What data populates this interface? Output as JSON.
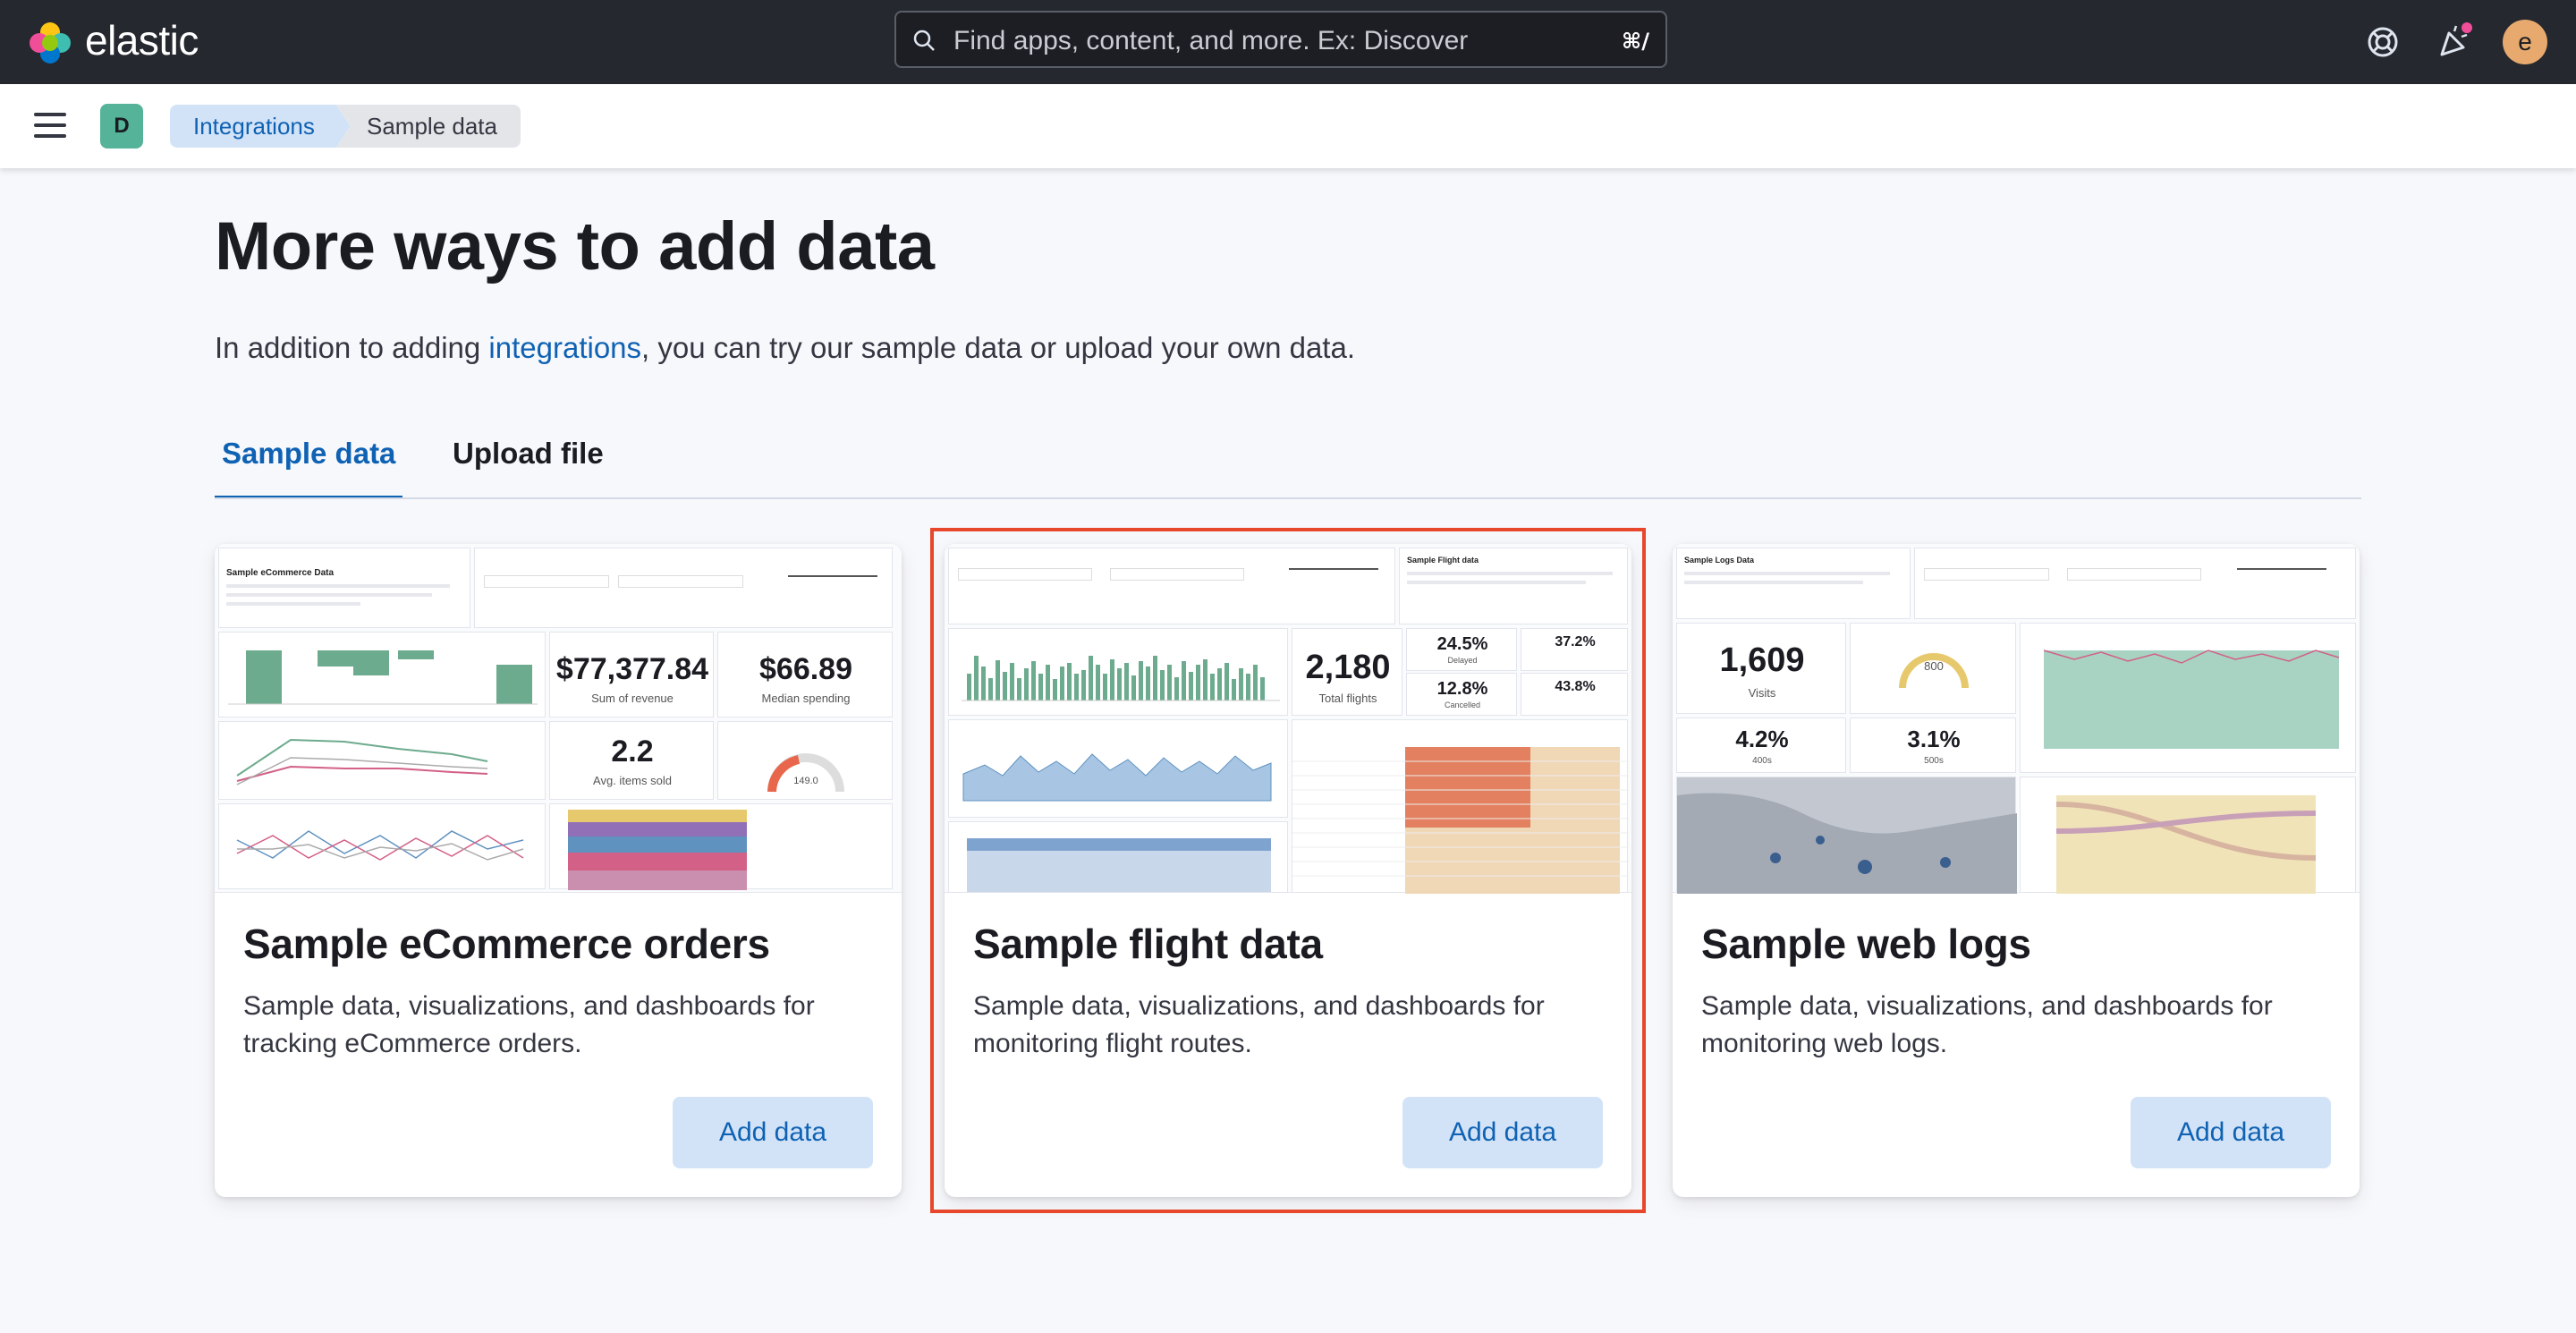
{
  "header": {
    "logo_text": "elastic",
    "search_placeholder": "Find apps, content, and more. Ex: Discover",
    "search_shortcut": "⌘/",
    "avatar_initial": "e",
    "icons": [
      "help-icon",
      "newsfeed-icon",
      "avatar"
    ]
  },
  "nav": {
    "space_initial": "D",
    "breadcrumbs": [
      "Integrations",
      "Sample data"
    ]
  },
  "page": {
    "title": "More ways to add data",
    "intro_before": "In addition to adding ",
    "intro_link": "integrations",
    "intro_after": ", you can try our sample data or upload your own data.",
    "tabs": [
      "Sample data",
      "Upload file"
    ],
    "selected_tab": "Sample data"
  },
  "cards": [
    {
      "title": "Sample eCommerce orders",
      "description": "Sample data, visualizations, and dashboards for tracking eCommerce orders.",
      "button": "Add data",
      "preview": {
        "heading": "Sample eCommerce Data",
        "stat1": "$77,377.84",
        "stat1_label": "Sum of revenue",
        "stat2": "$66.89",
        "stat2_label": "Median spending",
        "stat3": "2.2",
        "stat3_label": "Avg. items sold",
        "gauge": "149.0"
      }
    },
    {
      "title": "Sample flight data",
      "description": "Sample data, visualizations, and dashboards for monitoring flight routes.",
      "button": "Add data",
      "preview": {
        "heading": "Sample Flight data",
        "stat1": "2,180",
        "stat1_label": "Total flights",
        "delayed": "24.5%",
        "delayed_label": "Delayed",
        "cancelled": "12.8%",
        "cancelled_label": "Cancelled",
        "delay_pct": "37.2%",
        "cancel_pct": "43.8%"
      }
    },
    {
      "title": "Sample web logs",
      "description": "Sample data, visualizations, and dashboards for monitoring web logs.",
      "button": "Add data",
      "preview": {
        "heading": "Sample Logs Data",
        "stat1": "1,609",
        "stat1_label": "Visits",
        "gauge": "800",
        "stat2": "4.2%",
        "stat2_label": "400s",
        "stat3": "3.1%",
        "stat3_label": "500s"
      }
    }
  ],
  "colors": {
    "topbar": "#25282f",
    "link": "#0f62b3",
    "button_bg": "#d3e3f7",
    "highlight": "#e7472a",
    "chart_green": "#6dab8e",
    "chart_blue": "#6092c0",
    "chart_red": "#d36086"
  }
}
